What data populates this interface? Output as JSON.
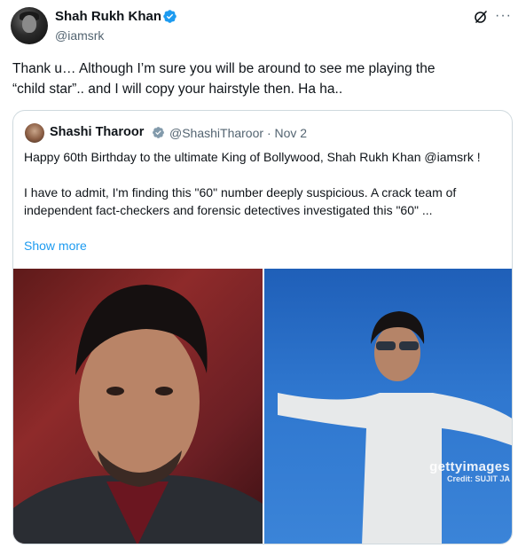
{
  "post": {
    "author_name": "Shah Rukh Khan",
    "author_handle": "@iamsrk",
    "text_line1": "Thank u… Although I’m sure you will be around to see me playing the",
    "text_line2": "“child star”.. and I will copy your hairstyle then. Ha ha..",
    "grok_icon": "grok-icon",
    "more_icon": "more-horizontal-icon",
    "more_glyph": "···",
    "verified_color": "#1d9bf0"
  },
  "quoted": {
    "author_name": "Shashi Tharoor",
    "author_handle": "@ShashiTharoor",
    "separator": "·",
    "date": "Nov 2",
    "paragraph1": "Happy 60th Birthday to the ultimate King of Bollywood, Shah Rukh Khan @iamsrk !",
    "paragraph2": "I have to admit, I'm finding this \"60\" number deeply suspicious. A crack team of independent fact-checkers and forensic detectives investigated this \"60\" ...",
    "show_more": "Show more",
    "link_color": "#1d9bf0",
    "watermark_brand": "gettyimages",
    "watermark_credit": "Credit: SUJIT JA"
  }
}
